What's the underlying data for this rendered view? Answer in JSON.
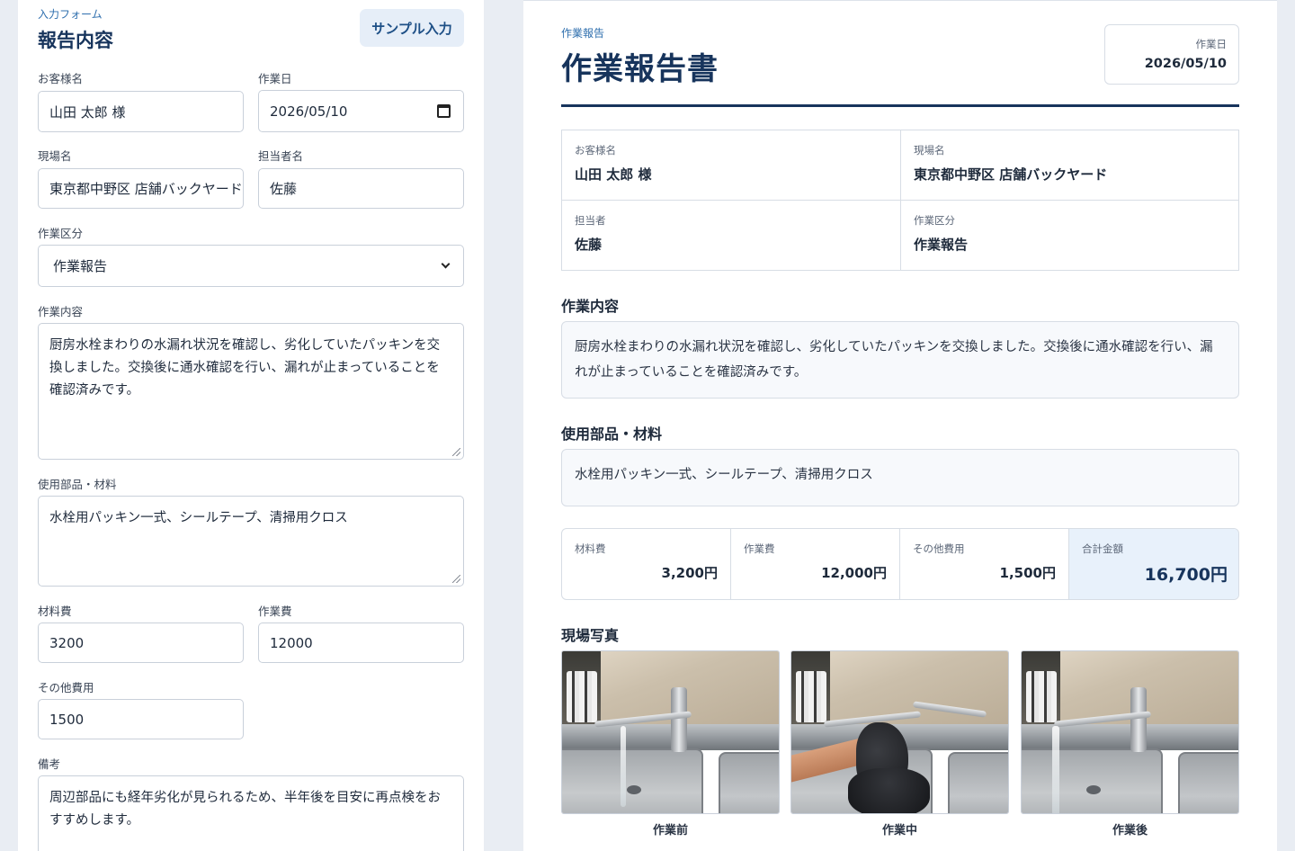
{
  "form": {
    "kicker": "入力フォーム",
    "title": "報告内容",
    "sample_button": "サンプル入力",
    "customer_label": "お客様名",
    "customer_value": "山田 太郎 様",
    "date_label": "作業日",
    "date_value": "2026/05/10",
    "site_label": "現場名",
    "site_value": "東京都中野区 店舗バックヤード",
    "staff_label": "担当者名",
    "staff_value": "佐藤",
    "category_label": "作業区分",
    "category_value": "作業報告",
    "content_label": "作業内容",
    "content_value": "厨房水栓まわりの水漏れ状況を確認し、劣化していたパッキンを交換しました。交換後に通水確認を行い、漏れが止まっていることを確認済みです。",
    "parts_label": "使用部品・材料",
    "parts_value": "水栓用パッキン一式、シールテープ、清掃用クロス",
    "material_cost_label": "材料費",
    "material_cost_value": "3200",
    "work_cost_label": "作業費",
    "work_cost_value": "12000",
    "other_cost_label": "その他費用",
    "other_cost_value": "1500",
    "remarks_label": "備考",
    "remarks_value": "周辺部品にも経年劣化が見られるため、半年後を目安に再点検をおすすめします。"
  },
  "report": {
    "kicker": "作業報告",
    "title": "作業報告書",
    "date_label": "作業日",
    "date_value": "2026/05/10",
    "customer_label": "お客様名",
    "customer_value": "山田 太郎 様",
    "site_label": "現場名",
    "site_value": "東京都中野区 店舗バックヤード",
    "staff_label": "担当者",
    "staff_value": "佐藤",
    "category_label": "作業区分",
    "category_value": "作業報告",
    "content_heading": "作業内容",
    "content_text": "厨房水栓まわりの水漏れ状況を確認し、劣化していたパッキンを交換しました。交換後に通水確認を行い、漏れが止まっていることを確認済みです。",
    "parts_heading": "使用部品・材料",
    "parts_text": "水栓用パッキン一式、シールテープ、清掃用クロス",
    "costs": {
      "material_label": "材料費",
      "material_value": "3,200円",
      "work_label": "作業費",
      "work_value": "12,000円",
      "other_label": "その他費用",
      "other_value": "1,500円",
      "total_label": "合計金額",
      "total_value": "16,700円"
    },
    "photos_heading": "現場写真",
    "photos": [
      {
        "caption": "作業前"
      },
      {
        "caption": "作業中"
      },
      {
        "caption": "作業後"
      }
    ]
  }
}
